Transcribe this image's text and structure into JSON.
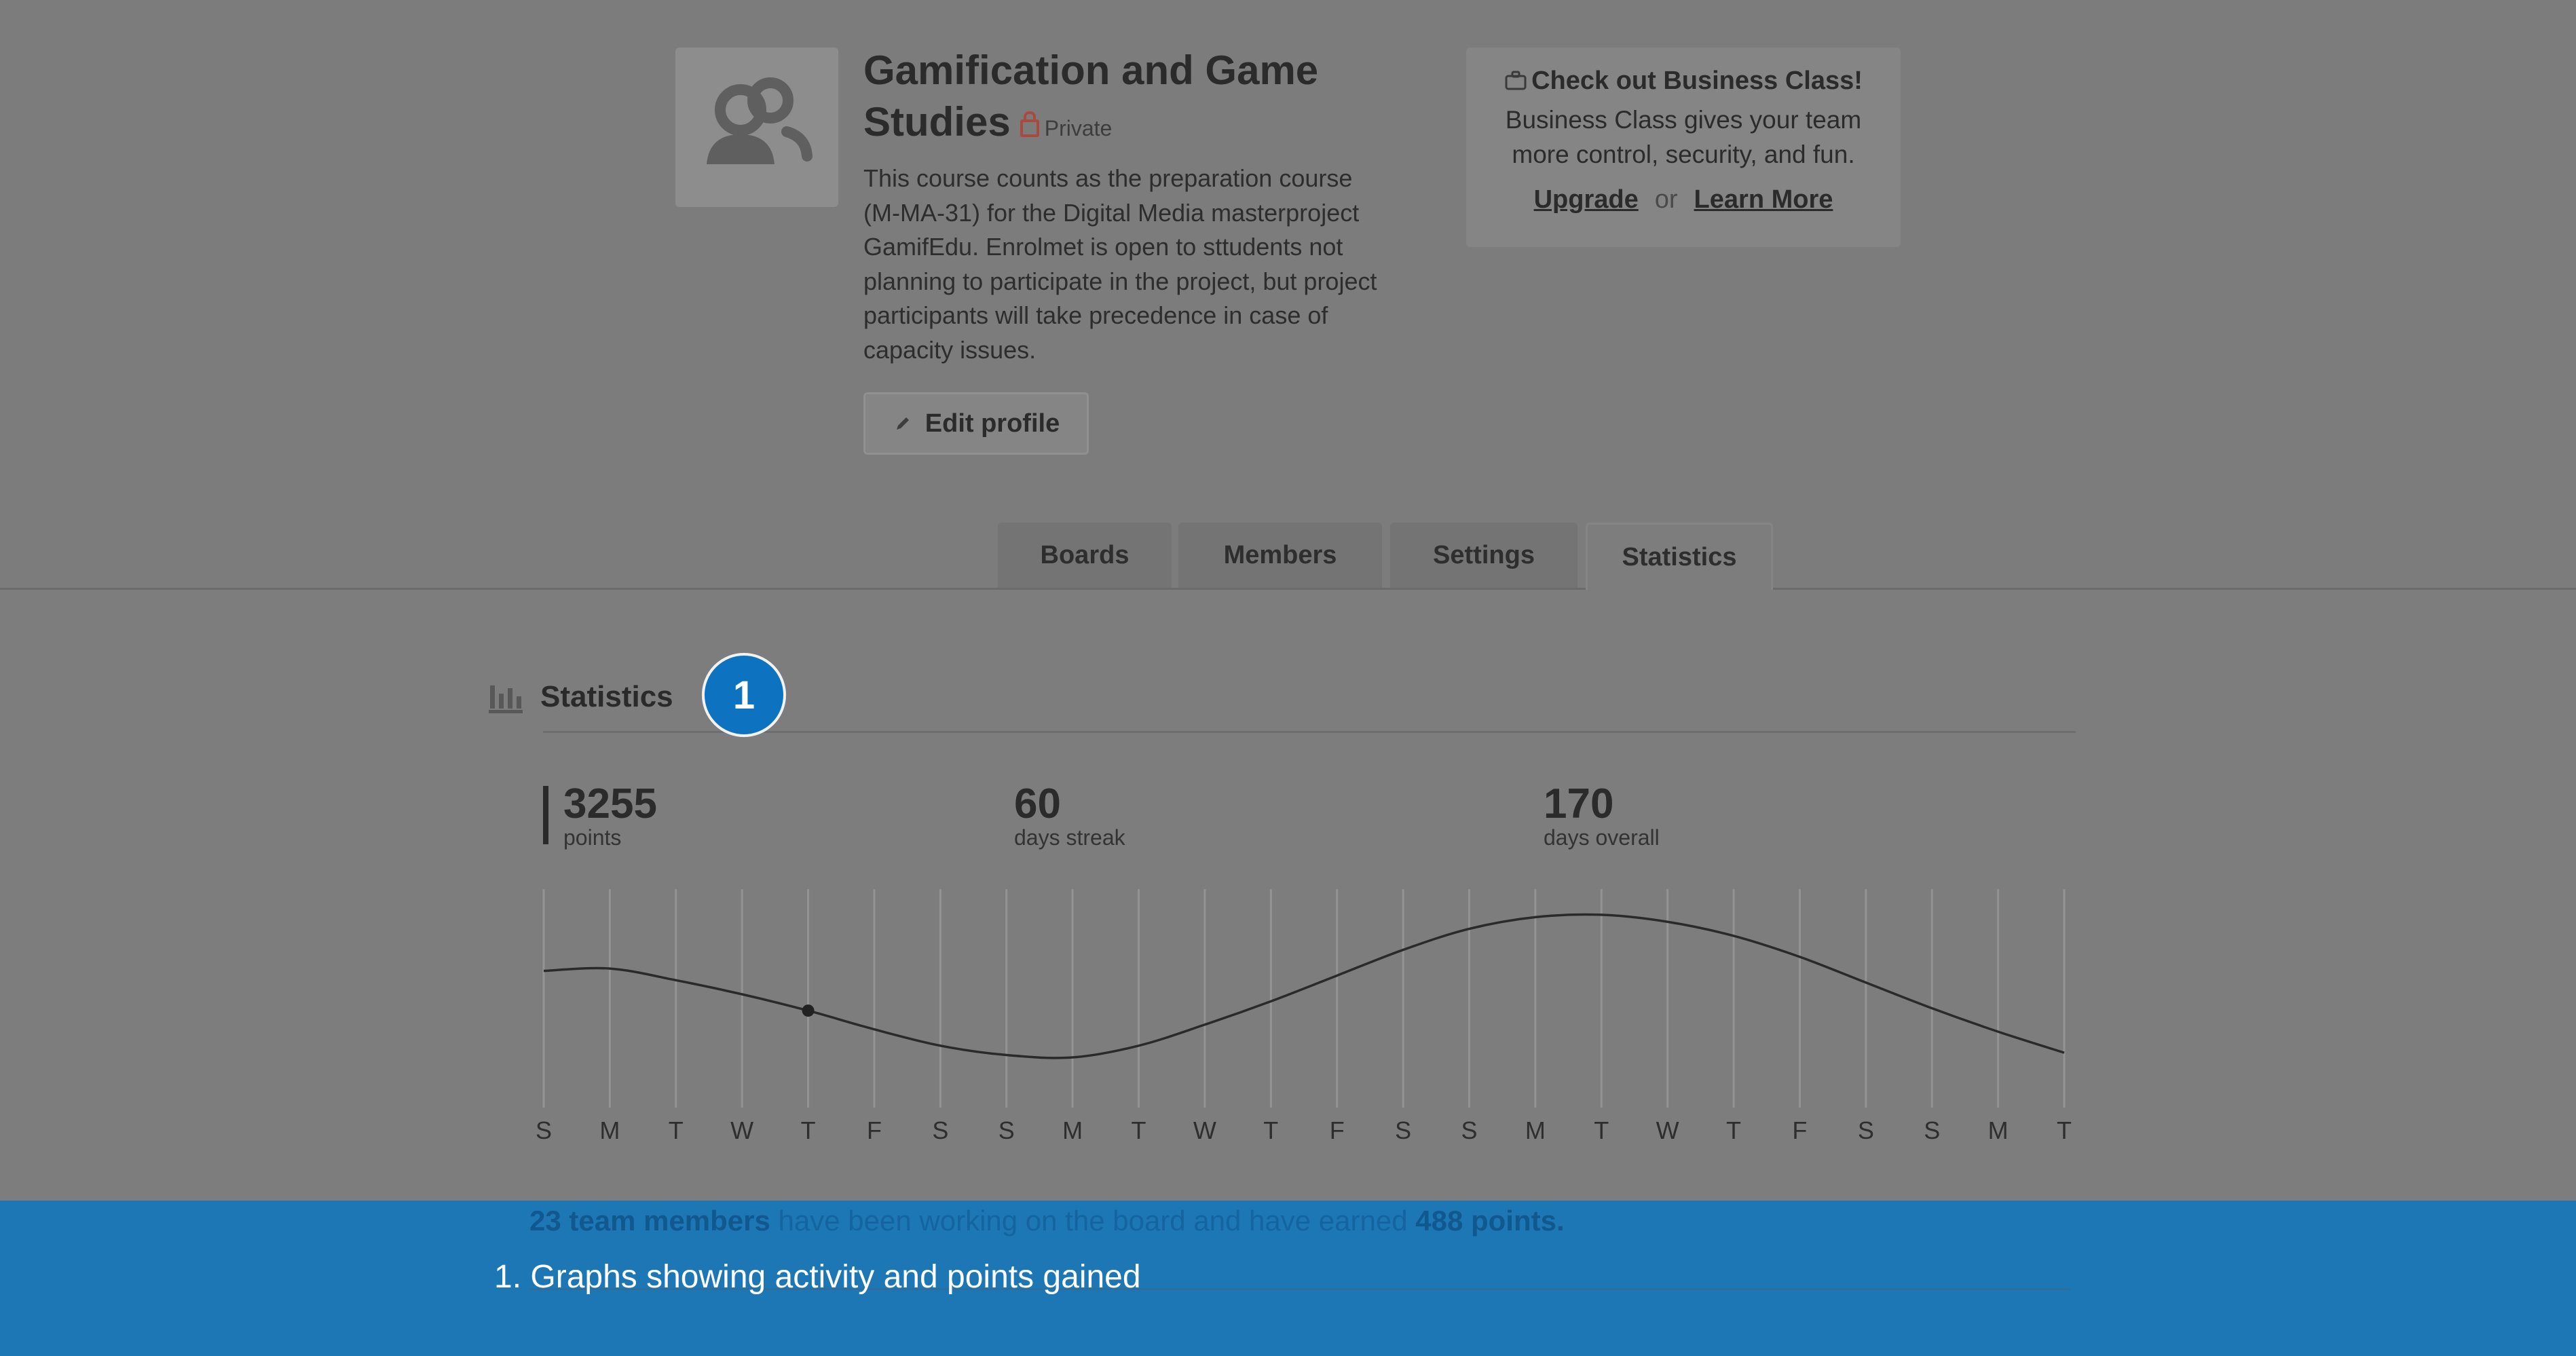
{
  "team": {
    "title": "Gamification and Game Studies",
    "title_line1": "Gamification and Game",
    "title_line2": "Studies",
    "visibility": "Private",
    "description": [
      "This course counts as the preparation course",
      "(M-MA-31) for the Digital Media masterproject",
      "GamifEdu. Enrolmet is open to sttudents not",
      "planning to participate in the project, but project",
      "participants will take precedence in case of",
      "capacity issues."
    ],
    "edit_label": "Edit profile"
  },
  "promo": {
    "title": "Check out Business Class!",
    "text_line1": "Business Class gives your team",
    "text_line2": "more control, security, and fun.",
    "upgrade": "Upgrade",
    "or": "or",
    "learn_more": "Learn More"
  },
  "tabs": [
    {
      "label": "Boards",
      "active": false
    },
    {
      "label": "Members",
      "active": false
    },
    {
      "label": "Settings",
      "active": false
    },
    {
      "label": "Statistics",
      "active": true
    }
  ],
  "statistics": {
    "heading": "Statistics",
    "callout_number": "1",
    "metrics": [
      {
        "value": "3255",
        "label": "points"
      },
      {
        "value": "60",
        "label": "days streak"
      },
      {
        "value": "170",
        "label": "days overall"
      }
    ],
    "summary": {
      "members": "23 team members",
      "middle": " have been working on the board and have earned ",
      "points": "488 points."
    }
  },
  "chart_data": {
    "type": "line",
    "title": "",
    "xlabel": "",
    "ylabel": "",
    "categories": [
      "S",
      "M",
      "T",
      "W",
      "T",
      "F",
      "S",
      "S",
      "M",
      "T",
      "W",
      "T",
      "F",
      "S",
      "S",
      "M",
      "T",
      "W",
      "T",
      "F",
      "S",
      "S",
      "M",
      "T"
    ],
    "values": [
      0.35,
      0.36,
      0.31,
      0.25,
      0.18,
      0.1,
      0.03,
      -0.01,
      -0.02,
      0.03,
      0.12,
      0.22,
      0.33,
      0.44,
      0.53,
      0.58,
      0.59,
      0.56,
      0.5,
      0.41,
      0.3,
      0.19,
      0.09,
      0.0
    ],
    "highlight_index": 4,
    "ylim": [
      -0.2,
      0.7
    ],
    "grid": "vertical"
  },
  "caption": "1. Graphs showing activity and points gained",
  "colors": {
    "accent": "#1d77b4",
    "badge": "#0d72c0"
  }
}
